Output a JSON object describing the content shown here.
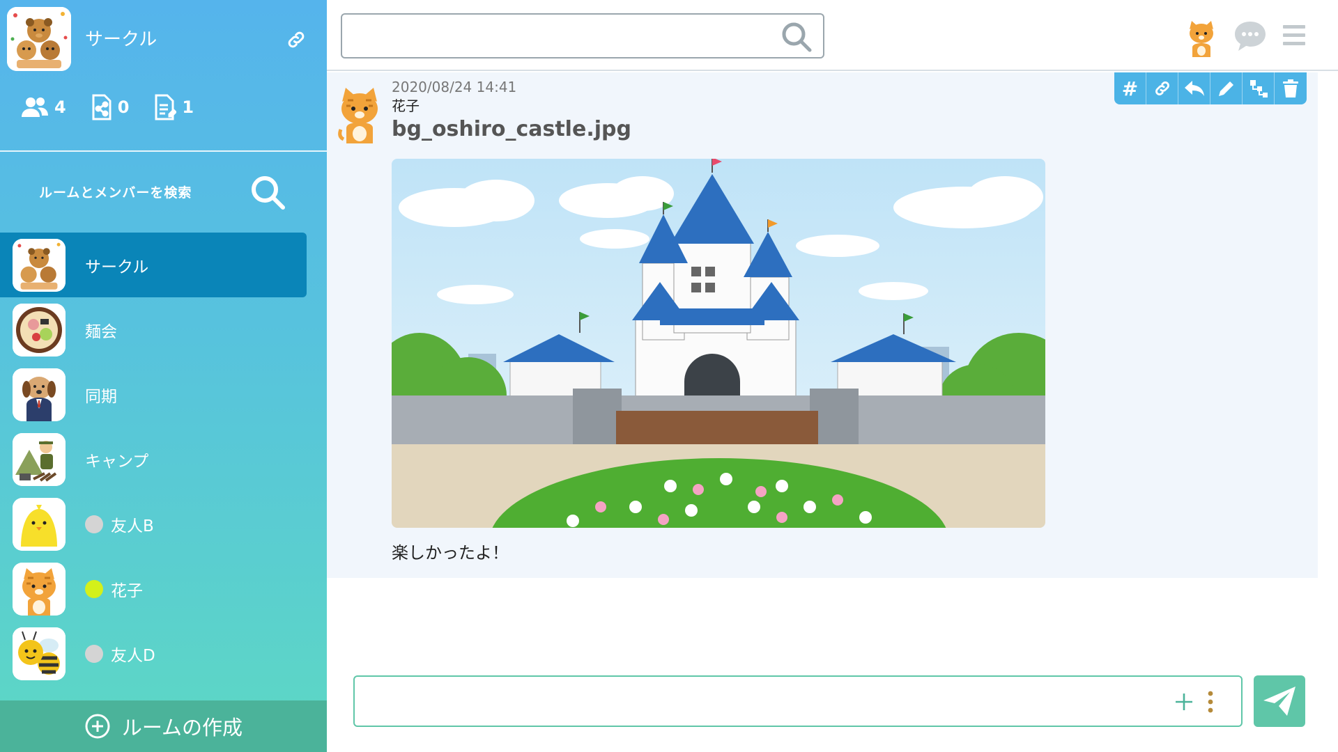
{
  "sidebar": {
    "group_name": "サークル",
    "stats": {
      "members": "4",
      "shared_files": "0",
      "notes": "1"
    },
    "search_label": "ルームとメンバーを検索",
    "rooms": [
      {
        "label": "サークル",
        "icon": "dogs-group-avatar",
        "active": true
      },
      {
        "label": "麺会",
        "icon": "ramen-avatar"
      },
      {
        "label": "同期",
        "icon": "dog-suit-avatar"
      },
      {
        "label": "キャンプ",
        "icon": "camp-avatar"
      },
      {
        "label": "友人B",
        "icon": "chick-avatar",
        "status": "offline"
      },
      {
        "label": "花子",
        "icon": "cat-avatar",
        "status": "online"
      },
      {
        "label": "友人D",
        "icon": "bee-avatar",
        "status": "offline"
      }
    ],
    "create_room_label": "ルームの作成"
  },
  "topbar": {
    "search_value": "",
    "search_placeholder": ""
  },
  "message": {
    "timestamp": "2020/08/24 14:41",
    "author": "花子",
    "file_name": "bg_oshiro_castle.jpg",
    "text": "楽しかったよ！",
    "actions": [
      "hash-icon",
      "link-icon",
      "reply-icon",
      "edit-icon",
      "thread-icon",
      "trash-icon"
    ]
  },
  "composer": {
    "value": "",
    "placeholder": ""
  },
  "colors": {
    "sidebar_top": "#55b4ec",
    "sidebar_bottom": "#5dd8c4",
    "active_room": "#0a85b8",
    "accent_green": "#5fc6a8",
    "status_online": "#d4f01a",
    "status_offline": "#d4d4d4",
    "action_bar": "#4bb3e6"
  }
}
